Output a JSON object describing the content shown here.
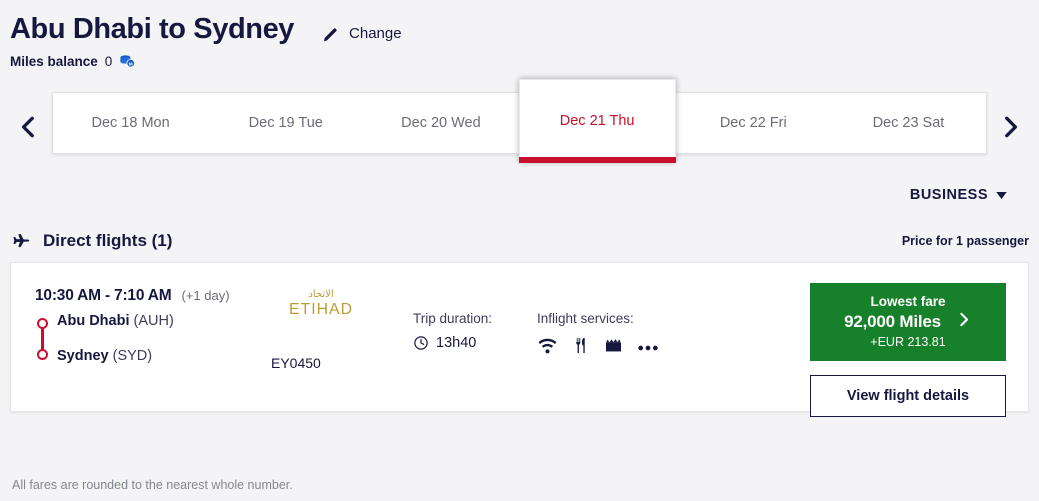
{
  "header": {
    "route_title": "Abu Dhabi to Sydney",
    "change_label": "Change",
    "miles_label": "Miles balance",
    "miles_value": "0",
    "pencil_icon": "pencil-icon",
    "coins_icon": "miles-coins-icon"
  },
  "date_strip": {
    "prev_icon": "chevron-left-icon",
    "next_icon": "chevron-right-icon",
    "dates": [
      {
        "label": "Dec 18 Mon",
        "selected": false
      },
      {
        "label": "Dec 19 Tue",
        "selected": false
      },
      {
        "label": "Dec 20 Wed",
        "selected": false
      },
      {
        "label": "Dec 21 Thu",
        "selected": true
      },
      {
        "label": "Dec 22 Fri",
        "selected": false
      },
      {
        "label": "Dec 23 Sat",
        "selected": false
      }
    ]
  },
  "cabin": {
    "label": "BUSINESS",
    "chevron_icon": "chevron-down-icon"
  },
  "results": {
    "heading": "Direct flights (1)",
    "plane_icon": "airplane-icon",
    "price_note": "Price for 1 passenger"
  },
  "flight": {
    "times": "10:30 AM - 7:10 AM",
    "day_offset": "(+1 day)",
    "origin_city": "Abu Dhabi",
    "origin_code": "(AUH)",
    "destination_city": "Sydney",
    "destination_code": "(SYD)",
    "airline_name": "ETIHAD",
    "airline_arabic": "الاتحاد",
    "flight_number": "EY0450",
    "duration_label": "Trip duration:",
    "duration_value": "13h40",
    "clock_icon": "clock-icon",
    "services_label": "Inflight services:",
    "services": [
      {
        "name": "wifi-icon"
      },
      {
        "name": "meal-icon"
      },
      {
        "name": "entertainment-icon"
      },
      {
        "name": "more-services-icon"
      }
    ],
    "fare": {
      "top_label": "Lowest fare",
      "miles": "92,000 Miles",
      "cash": "+EUR 213.81",
      "chevron_icon": "chevron-right-icon"
    },
    "details_label": "View flight details"
  },
  "footer": {
    "note": "All fares are rounded to the nearest whole number."
  },
  "colors": {
    "brand_navy": "#16183f",
    "accent_red": "#c8102e",
    "fare_green": "#17802a",
    "etihad_gold": "#bd9b36",
    "page_bg": "#f4f4f6"
  }
}
